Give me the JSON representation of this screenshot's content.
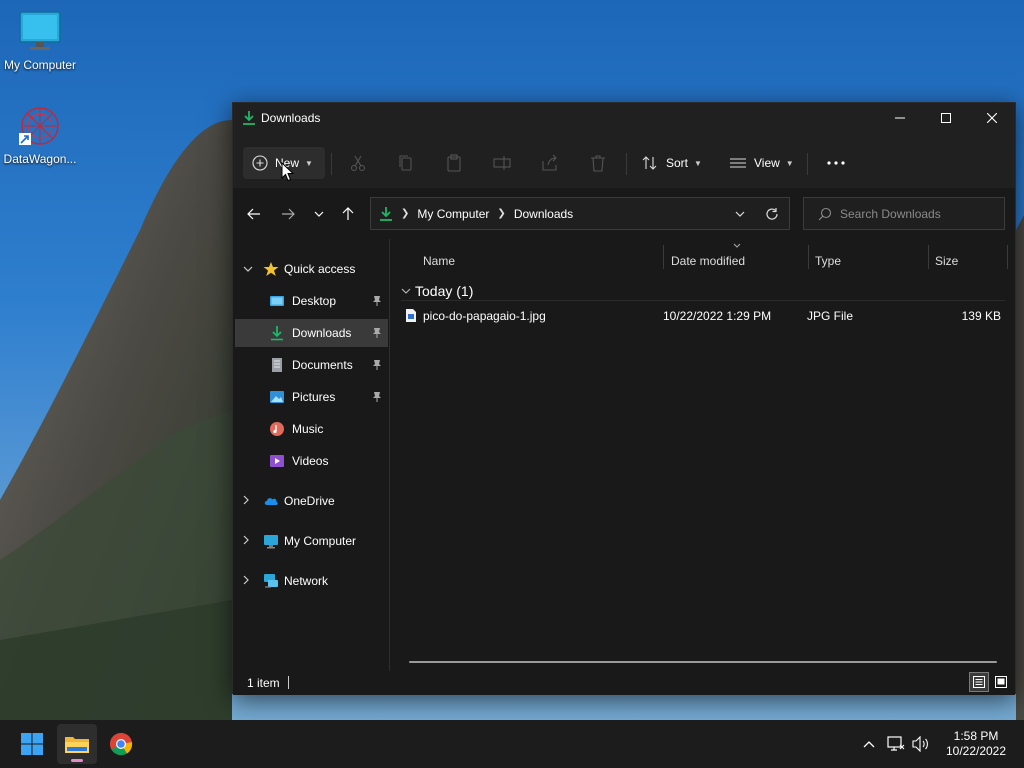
{
  "desktop": {
    "icons": [
      {
        "label": "My Computer",
        "icon": "monitor-icon"
      },
      {
        "label": "DataWagon...",
        "icon": "datawagon-icon"
      }
    ]
  },
  "window": {
    "title": "Downloads",
    "controls": {
      "minimize": "minimize-icon",
      "maximize": "maximize-icon",
      "close": "close-icon"
    }
  },
  "commandbar": {
    "new_label": "New",
    "sort_label": "Sort",
    "view_label": "View"
  },
  "address": {
    "breadcrumb": [
      "My Computer",
      "Downloads"
    ],
    "search_placeholder": "Search Downloads"
  },
  "nav": {
    "quick_access": "Quick access",
    "items": [
      {
        "label": "Desktop",
        "pinned": true
      },
      {
        "label": "Downloads",
        "pinned": true,
        "selected": true
      },
      {
        "label": "Documents",
        "pinned": true
      },
      {
        "label": "Pictures",
        "pinned": true
      },
      {
        "label": "Music",
        "pinned": false
      },
      {
        "label": "Videos",
        "pinned": false
      }
    ],
    "roots": [
      "OneDrive",
      "My Computer",
      "Network"
    ]
  },
  "columns": [
    "Name",
    "Date modified",
    "Type",
    "Size"
  ],
  "group": {
    "label": "Today (1)"
  },
  "files": [
    {
      "name": "pico-do-papagaio-1.jpg",
      "date": "10/22/2022 1:29 PM",
      "type": "JPG File",
      "size": "139 KB"
    }
  ],
  "status": {
    "count": "1 item"
  },
  "taskbar": {
    "time": "1:58 PM",
    "date": "10/22/2022"
  },
  "colors": {
    "accent_green": "#1db86a",
    "window_bg": "#191919",
    "selected": "#3a3a3a"
  }
}
